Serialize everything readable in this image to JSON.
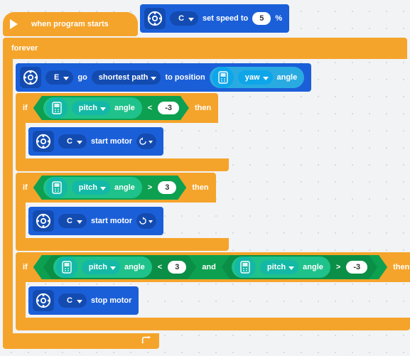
{
  "hat": {
    "label": "when program starts"
  },
  "set_speed": {
    "port": "C",
    "label_pre": "set speed to",
    "value": "5",
    "label_post": "%"
  },
  "forever": {
    "label": "forever"
  },
  "go_block": {
    "port": "E",
    "go": "go",
    "mode": "shortest path",
    "to_position": "to position",
    "sensor": "yaw",
    "angle": "angle"
  },
  "if_label": "if",
  "then_label": "then",
  "and_label": "and",
  "sensor_pitch": "pitch",
  "sensor_angle": "angle",
  "if1": {
    "op": "<",
    "val": "-3"
  },
  "start_motor1": {
    "port": "C",
    "label": "start motor",
    "dir": "ccw"
  },
  "if2": {
    "op": ">",
    "val": "3"
  },
  "start_motor2": {
    "port": "C",
    "label": "start motor",
    "dir": "cw"
  },
  "if3": {
    "op1": "<",
    "val1": "3",
    "op2": ">",
    "val2": "-3"
  },
  "stop_motor": {
    "port": "C",
    "label": "stop motor"
  }
}
